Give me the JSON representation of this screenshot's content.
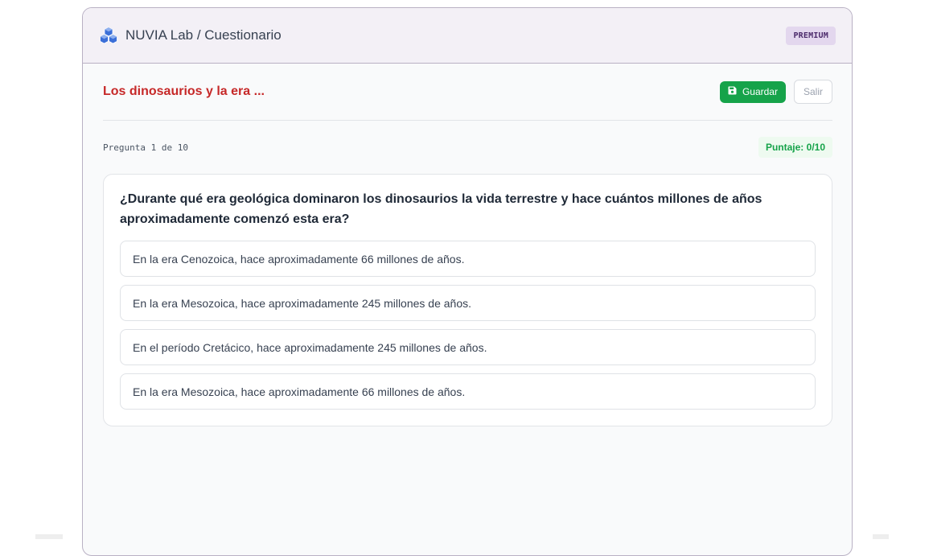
{
  "header": {
    "icon": "cubes-icon",
    "title": "NUVIA Lab / Cuestionario",
    "badge": "PREMIUM"
  },
  "toolbar": {
    "quiz_title": "Los dinosaurios y la era ...",
    "save_label": "Guardar",
    "save_icon": "floppy-disk-icon",
    "exit_label": "Salir"
  },
  "progress": {
    "counter": "Pregunta 1 de 10",
    "score": "Puntaje: 0/10"
  },
  "question": {
    "text": "¿Durante qué era geológica dominaron los dinosaurios la vida terrestre y hace cuántos millones de años aproximadamente comenzó esta era?",
    "options": [
      "En la era Cenozoica, hace aproximadamente 66 millones de años.",
      "En la era Mesozoica, hace aproximadamente 245 millones de años.",
      "En el período Cretácico, hace aproximadamente 245 millones de años.",
      "En la era Mesozoica, hace aproximadamente 66 millones de años."
    ]
  },
  "colors": {
    "brand_icon": "#3b6fd8",
    "quiz_title": "#c62828",
    "save_button": "#16a34a",
    "score_text": "#16a34a",
    "premium_badge_bg": "#e3d7ee"
  }
}
